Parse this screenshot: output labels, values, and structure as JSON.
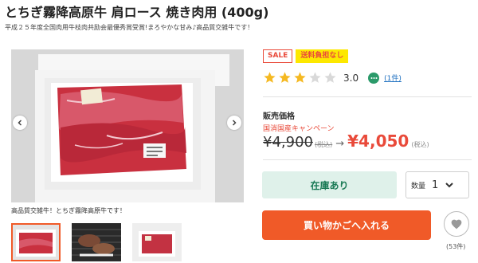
{
  "product": {
    "title": "とちぎ霧降高原牛 肩ロース 焼き肉用 (400g)",
    "subtitle": "平成２５年度全国肉用牛枝肉共励会最優秀賞受賞!まろやかな甘み♪高品質交雑牛です！",
    "image_caption": "高品質交雑牛！とちぎ霧降高原牛です！",
    "thumbnails": [
      "thumb-meat-pack",
      "thumb-grilled-meat",
      "thumb-meat-box"
    ],
    "active_thumbnail_index": 0
  },
  "badges": {
    "sale": "SALE",
    "shipping": "送料負担なし"
  },
  "rating": {
    "value": "3.0",
    "stars_filled": 3,
    "stars_total": 5,
    "reviews_link": "(1件)"
  },
  "price": {
    "label": "販売価格",
    "campaign": "国消国産キャンペーン",
    "old": "¥4,900",
    "old_tax": "(税込)",
    "new": "¥4,050",
    "new_tax": "(税込)",
    "arrow": "→"
  },
  "actions": {
    "stock": "在庫あり",
    "quantity_label": "数量",
    "quantity_value": "1",
    "add_to_cart": "買い物かごへ入れる",
    "favorite_count": "(53件)"
  },
  "colors": {
    "accent": "#f05a28",
    "sale_red": "#e94a3a",
    "star": "#f5b922",
    "stock_bg": "#dff1ea",
    "stock_text": "#1a7a55"
  },
  "icons": {
    "prev": "chevron-left-icon",
    "next": "chevron-right-icon",
    "review": "speech-bubble-icon",
    "favorite": "heart-icon",
    "dropdown": "chevron-down-icon"
  }
}
